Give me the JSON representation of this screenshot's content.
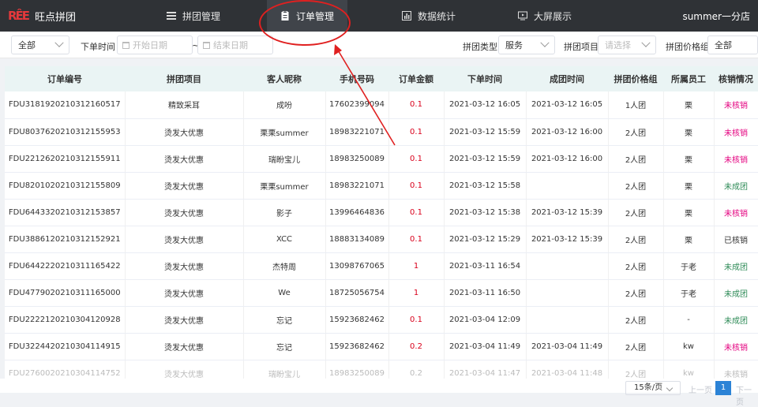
{
  "header": {
    "logo_mark": "RÊE",
    "app_name": "旺点拼团",
    "nav": [
      {
        "label": "拼团管理",
        "icon": "menu-icon"
      },
      {
        "label": "订单管理",
        "icon": "clipboard-icon"
      },
      {
        "label": "数据统计",
        "icon": "chart-icon"
      },
      {
        "label": "大屏展示",
        "icon": "screen-icon"
      }
    ],
    "user": "summer一分店"
  },
  "filters": {
    "status_value": "全部",
    "order_time_label": "下单时间",
    "start_placeholder": "开始日期",
    "range_sep": "~",
    "end_placeholder": "结束日期",
    "type_label": "拼团类型",
    "type_value": "服务",
    "project_label": "拼团项目",
    "project_placeholder": "请选择",
    "price_group_label": "拼团价格组",
    "price_group_value": "全部"
  },
  "table": {
    "columns": [
      "订单编号",
      "拼团项目",
      "客人昵称",
      "手机号码",
      "订单金额",
      "下单时间",
      "成团时间",
      "拼团价格组",
      "所属员工",
      "核销情况"
    ],
    "rows": [
      [
        "FDU3181920210312160517",
        "精致采耳",
        "成吩",
        "17602399094",
        "0.1",
        "2021-03-12 16:05",
        "2021-03-12 16:05",
        "1人团",
        "栗",
        "未核销"
      ],
      [
        "FDU8037620210312155953",
        "烫发大优惠",
        "栗栗summer",
        "18983221071",
        "0.1",
        "2021-03-12 15:59",
        "2021-03-12 16:00",
        "2人团",
        "栗",
        "未核销"
      ],
      [
        "FDU2212620210312155911",
        "烫发大优惠",
        "瑞盼宝儿",
        "18983250089",
        "0.1",
        "2021-03-12 15:59",
        "2021-03-12 16:00",
        "2人团",
        "栗",
        "未核销"
      ],
      [
        "FDU8201020210312155809",
        "烫发大优惠",
        "栗栗summer",
        "18983221071",
        "0.1",
        "2021-03-12 15:58",
        "",
        "2人团",
        "栗",
        "未成团"
      ],
      [
        "FDU6443320210312153857",
        "烫发大优惠",
        "影子",
        "13996464836",
        "0.1",
        "2021-03-12 15:38",
        "2021-03-12 15:39",
        "2人团",
        "栗",
        "未核销"
      ],
      [
        "FDU3886120210312152921",
        "烫发大优惠",
        "XCC",
        "18883134089",
        "0.1",
        "2021-03-12 15:29",
        "2021-03-12 15:39",
        "2人团",
        "栗",
        "已核销"
      ],
      [
        "FDU6442220210311165422",
        "烫发大优惠",
        "杰特周",
        "13098767065",
        "1",
        "2021-03-11 16:54",
        "",
        "2人团",
        "于老",
        "未成团"
      ],
      [
        "FDU4779020210311165000",
        "烫发大优惠",
        "We",
        "18725056754",
        "1",
        "2021-03-11 16:50",
        "",
        "2人团",
        "于老",
        "未成团"
      ],
      [
        "FDU2222120210304120928",
        "烫发大优惠",
        "忘记",
        "15923682462",
        "0.1",
        "2021-03-04 12:09",
        "",
        "2人团",
        "-",
        "未成团"
      ],
      [
        "FDU3224420210304114915",
        "烫发大优惠",
        "忘记",
        "15923682462",
        "0.2",
        "2021-03-04 11:49",
        "2021-03-04 11:49",
        "2人团",
        "kw",
        "未核销"
      ],
      [
        "FDU2760020210304114752",
        "烫发大优惠",
        "瑞盼宝儿",
        "18983250089",
        "0.2",
        "2021-03-04 11:47",
        "2021-03-04 11:48",
        "2人团",
        "kw",
        "未核销"
      ]
    ]
  },
  "pagination": {
    "page_size": "15条/页",
    "prev": "上一页",
    "current": "1",
    "next": "下一页"
  },
  "colors": {
    "topbar": "#2f3236",
    "amount": "#d9001b",
    "not_verified": "#e4007f",
    "not_formed": "#2e8b57",
    "annotation": "#e02020"
  }
}
